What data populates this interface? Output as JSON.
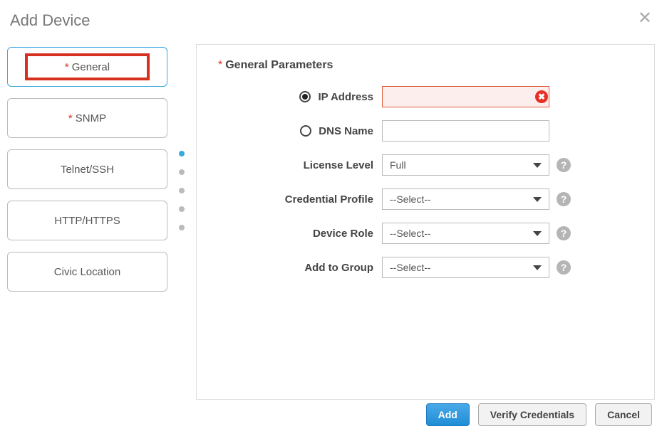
{
  "title": "Add Device",
  "sidebar": {
    "items": [
      {
        "label": "General",
        "required": true,
        "active": true
      },
      {
        "label": "SNMP",
        "required": true,
        "active": false
      },
      {
        "label": "Telnet/SSH",
        "required": false,
        "active": false
      },
      {
        "label": "HTTP/HTTPS",
        "required": false,
        "active": false
      },
      {
        "label": "Civic Location",
        "required": false,
        "active": false
      }
    ]
  },
  "panel": {
    "title": "General Parameters",
    "ip_label": "IP Address",
    "ip_value": "",
    "ip_error": true,
    "dns_label": "DNS Name",
    "dns_value": "",
    "address_mode": "ip",
    "license_label": "License Level",
    "license_value": "Full",
    "credential_label": "Credential Profile",
    "credential_value": "--Select--",
    "role_label": "Device Role",
    "role_value": "--Select--",
    "group_label": "Add to Group",
    "group_value": "--Select--"
  },
  "footer": {
    "add": "Add",
    "verify": "Verify Credentials",
    "cancel": "Cancel"
  }
}
